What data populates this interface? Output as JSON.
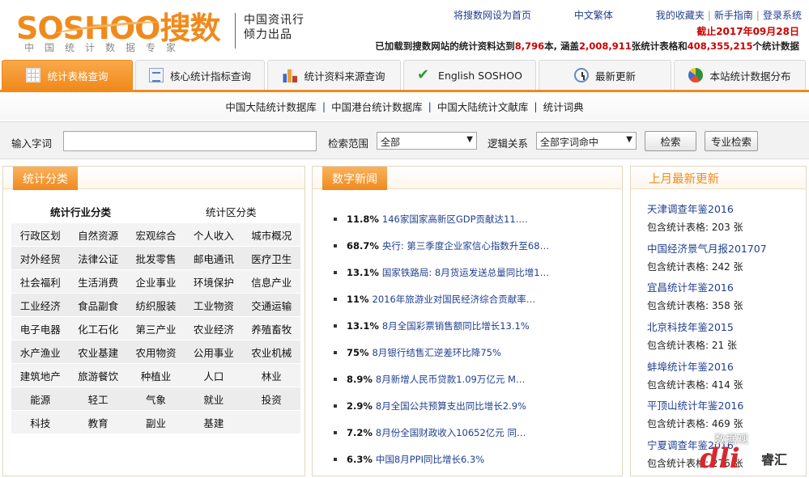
{
  "header": {
    "logo_text": "SOSHOO搜数",
    "logo_sub": "中国统计数据专家",
    "tagline_line1": "中国资讯行",
    "tagline_line2": "倾力出品",
    "links": [
      "将搜数网设为首页",
      "中文繁体",
      "我的收藏夹",
      "新手指南",
      "登录系统"
    ],
    "deadline": "截止2017年09月28日",
    "stat_prefix": "已加载到搜数网站的统计资料达到",
    "stat_books": "8,796",
    "stat_mid1": "本, 涵盖",
    "stat_tables": "2,008,911",
    "stat_mid2": "张统计表格和",
    "stat_entries": "408,355,215",
    "stat_suffix": "个统计数据"
  },
  "tabs": [
    {
      "label": "统计表格查询",
      "icon": "table-icon"
    },
    {
      "label": "核心统计指标查询",
      "icon": "document-icon"
    },
    {
      "label": "统计资料来源查询",
      "icon": "bar-chart-icon"
    },
    {
      "label": "English SOSHOO",
      "icon": "check-icon"
    },
    {
      "label": "最新更新",
      "icon": "clock-icon"
    },
    {
      "label": "本站统计数据分布",
      "icon": "pie-chart-icon"
    }
  ],
  "sublinks": [
    "中国大陆统计数据库",
    "中国港台统计数据库",
    "中国大陆统计文献库",
    "统计词典"
  ],
  "search": {
    "input_label": "输入字词",
    "input_value": "",
    "scope_label": "检索范围",
    "scope_value": "全部",
    "logic_label": "逻辑关系",
    "logic_value": "全部字词命中",
    "search_button": "检索",
    "advanced_button": "专业检索"
  },
  "categories": {
    "title": "统计分类",
    "industry_heading": "统计行业分类",
    "region_heading": "统计区分类",
    "items": [
      "行政区划",
      "自然资源",
      "宏观综合",
      "个人收入",
      "城市概况",
      "对外经贸",
      "法律公证",
      "批发零售",
      "邮电通讯",
      "医疗卫生",
      "社会福利",
      "生活消费",
      "企业事业",
      "环境保护",
      "信息产业",
      "工业经济",
      "食品副食",
      "纺织服装",
      "工业物资",
      "交通运输",
      "电子电器",
      "化工石化",
      "第三产业",
      "农业经济",
      "养殖畜牧",
      "水产渔业",
      "农业基建",
      "农用物资",
      "公用事业",
      "农业机械",
      "建筑地产",
      "旅游餐饮",
      "种植业",
      "人口",
      "林业",
      "能源",
      "轻工",
      "气象",
      "就业",
      "投资",
      "科技",
      "教育",
      "副业",
      "基建",
      ""
    ]
  },
  "news": {
    "title": "数字新闻",
    "items": [
      {
        "pct": "11.8%",
        "text": "146家国家高新区GDP贡献达11.…"
      },
      {
        "pct": "68.7%",
        "text": "央行: 第三季度企业家信心指数升至68…"
      },
      {
        "pct": "13.1%",
        "text": "国家铁路局: 8月货运发送总量同比增1…"
      },
      {
        "pct": "11%",
        "text": "2016年旅游业对国民经济综合贡献率…"
      },
      {
        "pct": "13.1%",
        "text": "8月全国彩票销售额同比增长13.1%"
      },
      {
        "pct": "75%",
        "text": "8月银行结售汇逆差环比降75%"
      },
      {
        "pct": "8.9%",
        "text": "8月新增人民币贷款1.09万亿元 M…"
      },
      {
        "pct": "2.9%",
        "text": "8月全国公共预算支出同比增长2.9%"
      },
      {
        "pct": "7.2%",
        "text": "8月份全国财政收入10652亿元 同…"
      },
      {
        "pct": "6.3%",
        "text": "中国8月PPI同比增长6.3%"
      }
    ]
  },
  "updates": {
    "title": "上月最新更新",
    "items": [
      {
        "name": "天津调查年鉴2016",
        "count": "包含统计表格: 203 张"
      },
      {
        "name": "中国经济景气月报201707",
        "count": "包含统计表格: 242 张"
      },
      {
        "name": "宜昌统计年鉴2016",
        "count": "包含统计表格: 358 张"
      },
      {
        "name": "北京科技年鉴2015",
        "count": "包含统计表格: 21 张"
      },
      {
        "name": "蚌埠统计年鉴2016",
        "count": "包含统计表格: 414 张"
      },
      {
        "name": "平顶山统计年鉴2016",
        "count": "包含统计表格: 469 张"
      },
      {
        "name": "宁夏调查年鉴2016",
        "count": "包含统计表格: 276 张"
      }
    ]
  },
  "watermark": {
    "text": "数据观",
    "mark": "dli",
    "brand": "睿汇"
  }
}
